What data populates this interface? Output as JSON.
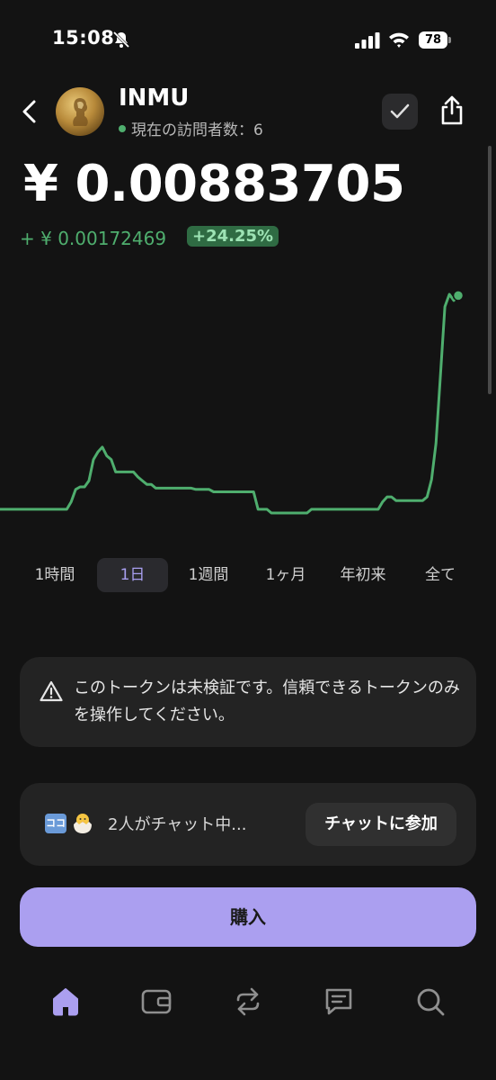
{
  "status_bar": {
    "time": "15:08",
    "battery": "78"
  },
  "header": {
    "token_name": "INMU",
    "visitors": "現在の訪問者数：6"
  },
  "price": {
    "current": "¥ 0.00883705",
    "change": "+ ¥ 0.00172469",
    "change_pct": "+24.25%"
  },
  "chart_data": {
    "type": "line",
    "color": "#4fae6e",
    "y": [
      0.00712,
      0.00712,
      0.00712,
      0.00712,
      0.00712,
      0.00712,
      0.00712,
      0.00712,
      0.00712,
      0.00712,
      0.00712,
      0.00712,
      0.00712,
      0.00712,
      0.00712,
      0.00712,
      0.00718,
      0.00728,
      0.0073,
      0.0073,
      0.00735,
      0.00752,
      0.00758,
      0.00762,
      0.00755,
      0.00752,
      0.00742,
      0.00742,
      0.00742,
      0.00742,
      0.00742,
      0.00738,
      0.00735,
      0.00732,
      0.00732,
      0.00729,
      0.00729,
      0.00729,
      0.00729,
      0.00729,
      0.00729,
      0.00729,
      0.00729,
      0.00729,
      0.00728,
      0.00728,
      0.00728,
      0.00728,
      0.00726,
      0.00726,
      0.00726,
      0.00726,
      0.00726,
      0.00726,
      0.00726,
      0.00726,
      0.00726,
      0.00726,
      0.00712,
      0.00712,
      0.00712,
      0.00709,
      0.00709,
      0.00709,
      0.00709,
      0.00709,
      0.00709,
      0.00709,
      0.00709,
      0.00709,
      0.00712,
      0.00712,
      0.00712,
      0.00712,
      0.00712,
      0.00712,
      0.00712,
      0.00712,
      0.00712,
      0.00712,
      0.00712,
      0.00712,
      0.00712,
      0.00712,
      0.00712,
      0.00712,
      0.00718,
      0.00722,
      0.00722,
      0.00719,
      0.00719,
      0.00719,
      0.00719,
      0.00719,
      0.00719,
      0.00719,
      0.00722,
      0.00736,
      0.00765,
      0.0082,
      0.00875,
      0.00885,
      0.0088,
      0.00884
    ]
  },
  "timeframes": [
    "1時間",
    "1日",
    "1週間",
    "1ヶ月",
    "年初来",
    "全て"
  ],
  "warning": {
    "text": "このトークンは未検証です。信頼できるトークンのみを操作してください。"
  },
  "chat": {
    "emoji_label": "ココ",
    "text": "2人がチャット中...",
    "join_label": "チャットに参加"
  },
  "buy": {
    "label": "購入"
  },
  "nav": {
    "items": [
      "home-icon",
      "wallet-icon",
      "swap-icon",
      "chat-icon",
      "search-icon"
    ],
    "active_color": "#ab9ff0"
  }
}
